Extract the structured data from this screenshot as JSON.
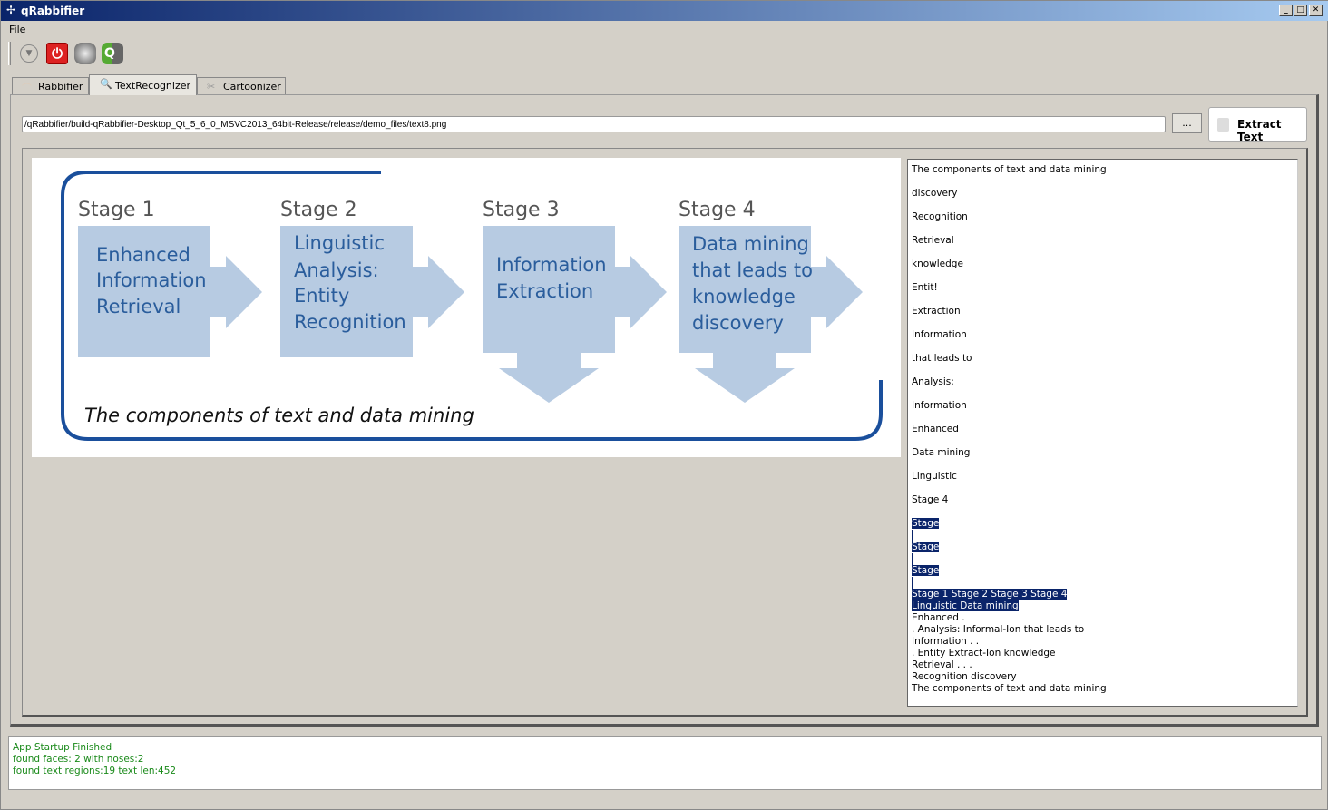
{
  "window": {
    "title": "qRabbifier",
    "minimize": "_",
    "maximize": "□",
    "close": "✕"
  },
  "menu": {
    "file": "File"
  },
  "toolbar": {
    "icons": [
      "dropdown-icon",
      "power-icon",
      "face-icon",
      "face-q-icon"
    ]
  },
  "tabs": [
    {
      "label": "Rabbifier"
    },
    {
      "label": "TextRecognizer",
      "active": true
    },
    {
      "label": "Cartoonizer"
    }
  ],
  "path_input": {
    "value": "/qRabbifier/build-qRabbifier-Desktop_Qt_5_6_0_MSVC2013_64bit-Release/release/demo_files/text8.png"
  },
  "browse_label": "...",
  "extract_label": "Extract Text",
  "diagram": {
    "stages": [
      "Stage 1",
      "Stage 2",
      "Stage 3",
      "Stage 4"
    ],
    "boxes": [
      [
        "Enhanced",
        "Information",
        "Retrieval"
      ],
      [
        "Linguistic",
        "Analysis:",
        "Entity",
        "Recognition"
      ],
      [
        "Information",
        "Extraction"
      ],
      [
        "Data mining",
        "that leads to",
        "knowledge",
        "discovery"
      ]
    ],
    "caption": "The components of text and data mining",
    "colors": {
      "box": "#b7cbe2",
      "text": "#2a5d9c",
      "border": "#1a4f9c"
    }
  },
  "results": {
    "entries": [
      "The components of text and data mining",
      "discovery",
      "Recognition",
      "Retrieval",
      "knowledge",
      "Entit!",
      "Extraction",
      "Information",
      "that leads to",
      "Analysis:",
      "Information",
      "Enhanced",
      "Data mining",
      "Linguistic",
      "Stage 4"
    ],
    "selected": [
      "Stage",
      "Stage",
      "Stage"
    ],
    "block_selected": [
      "Stage 1 Stage 2 Stage 3 Stage 4",
      "Linguistic Data mining"
    ],
    "block": [
      "Enhanced .",
      ". Analysis: Informal-Ion that leads to",
      "Information . .",
      ". Entity Extract-Ion knowledge",
      "Retrieval . . .",
      "Recognition discovery",
      "The components of text and data mining"
    ]
  },
  "log": [
    "App Startup Finished",
    "found faces: 2 with noses:2",
    "found text regions:19 text len:452"
  ]
}
